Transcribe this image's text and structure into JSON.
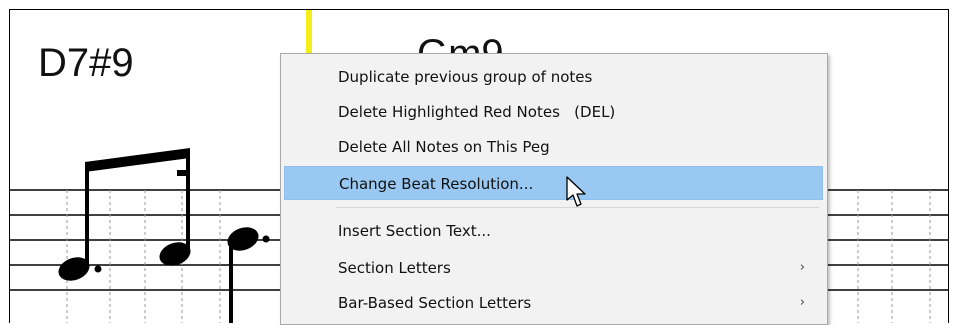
{
  "score": {
    "chords": [
      "D7#9",
      "Gm9"
    ]
  },
  "context_menu": {
    "items": [
      {
        "label": "Duplicate previous group of notes",
        "submenu": false
      },
      {
        "label": "Delete Highlighted Red Notes   (DEL)",
        "submenu": false
      },
      {
        "label": "Delete All Notes on This Peg",
        "submenu": false
      },
      {
        "label": "Change Beat Resolution...",
        "submenu": false,
        "highlighted": true
      },
      {
        "label": "Insert Section Text...",
        "submenu": false
      },
      {
        "label": "Section Letters",
        "submenu": true,
        "arrow": "›"
      },
      {
        "label": "Bar-Based Section Letters",
        "submenu": true,
        "arrow": "›"
      }
    ]
  },
  "colors": {
    "menu_background": "#f2f2f2",
    "highlight": "#99c9f3",
    "playhead": "#f3ef1a"
  }
}
